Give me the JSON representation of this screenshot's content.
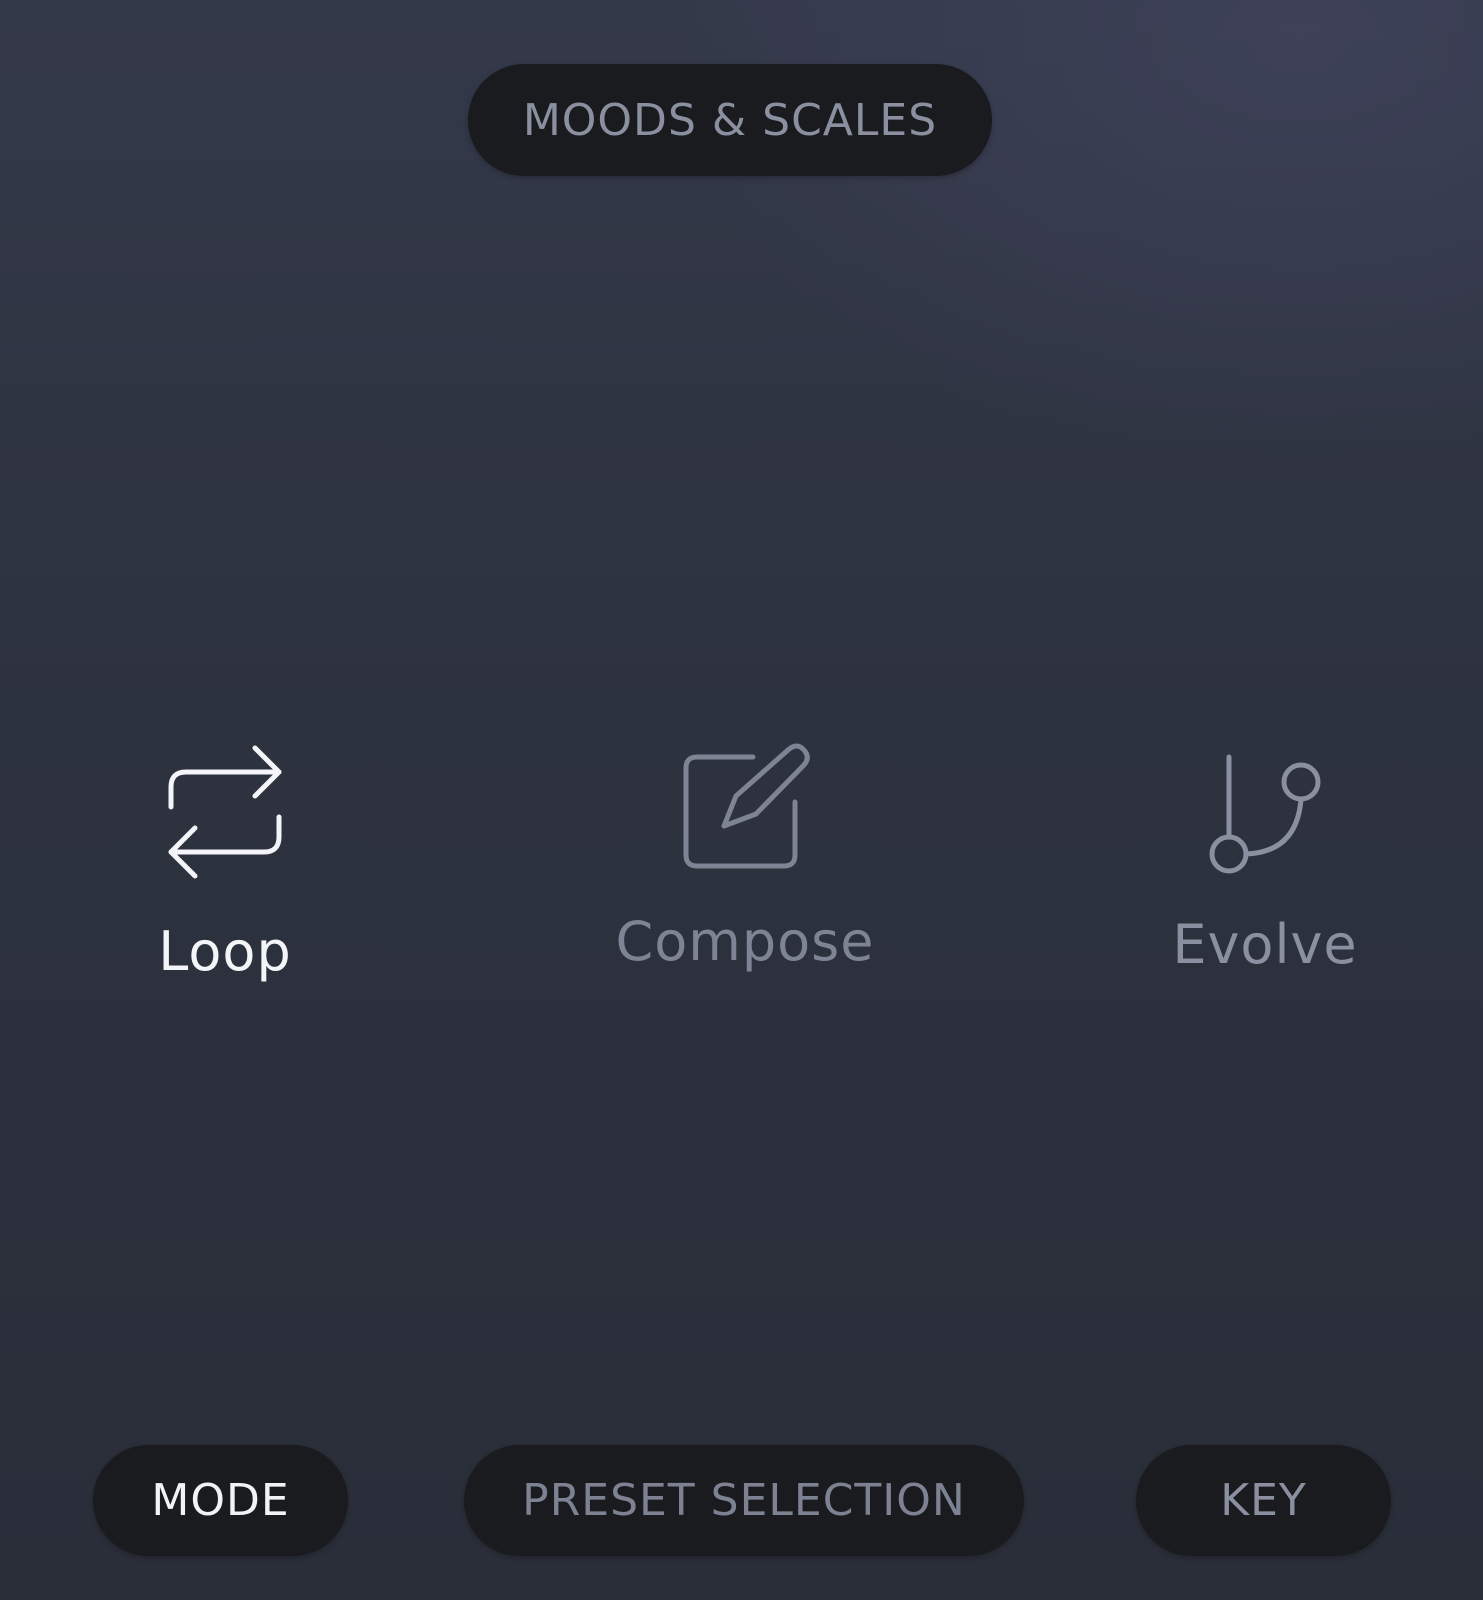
{
  "header": {
    "title": "MOODS & SCALES"
  },
  "modes": {
    "selected": "Loop",
    "items": [
      {
        "label": "Loop",
        "icon": "loop-icon",
        "active": true
      },
      {
        "label": "Compose",
        "icon": "edit-icon",
        "active": false
      },
      {
        "label": "Evolve",
        "icon": "branch-icon",
        "active": false
      }
    ]
  },
  "bottom_bar": {
    "mode_label": "MODE",
    "preset_label": "PRESET SELECTION",
    "key_label": "KEY"
  },
  "colors": {
    "active_text": "#f4f5f8",
    "inactive_text": "#7e8494",
    "pill_background": "#1a1b1e",
    "background": "#2d323f"
  }
}
